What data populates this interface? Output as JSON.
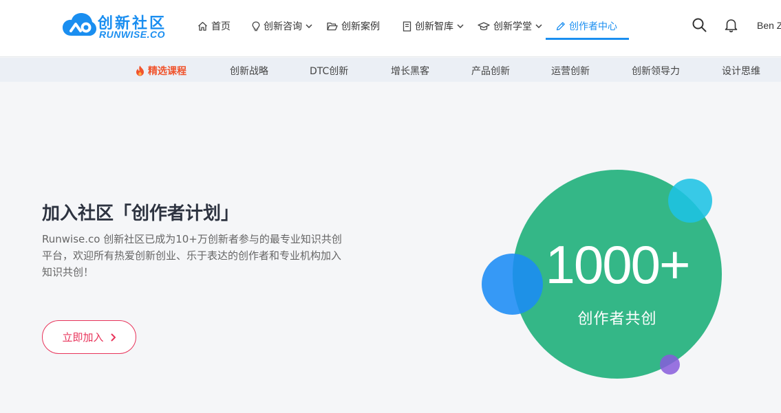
{
  "brand": {
    "name_cn": "创新社区",
    "name_en": "RUNWISE.CO",
    "color": "#1a8ef0"
  },
  "nav": {
    "items": [
      {
        "label": "首页",
        "icon": "home-icon",
        "dropdown": false,
        "active": false
      },
      {
        "label": "创新咨询",
        "icon": "lightbulb-icon",
        "dropdown": true,
        "active": false
      },
      {
        "label": "创新案例",
        "icon": "folder-open-icon",
        "dropdown": false,
        "active": false
      },
      {
        "label": "创新智库",
        "icon": "book-icon",
        "dropdown": true,
        "active": false
      },
      {
        "label": "创新学堂",
        "icon": "graduation-cap-icon",
        "dropdown": true,
        "active": false
      },
      {
        "label": "创作者中心",
        "icon": "pencil-icon",
        "dropdown": false,
        "active": true
      }
    ],
    "user_name": "Ben Z"
  },
  "subnav": {
    "items": [
      {
        "label": "精选课程",
        "hot": true
      },
      {
        "label": "创新战略"
      },
      {
        "label": "DTC创新"
      },
      {
        "label": "增长黑客"
      },
      {
        "label": "产品创新"
      },
      {
        "label": "运营创新"
      },
      {
        "label": "创新领导力"
      },
      {
        "label": "设计思维"
      }
    ],
    "hot_color": "#f0542d"
  },
  "hero": {
    "title": "加入社区「创作者计划」",
    "description": "Runwise.co 创新社区已成为10+万创新者参与的最专业知识共创平台，欢迎所有热爱创新创业、乐于表达的创作者和专业机构加入知识共创！",
    "cta_label": "立即加入",
    "cta_color": "#e8335a"
  },
  "stat": {
    "value": "1000+",
    "label": "创作者共创",
    "colors": {
      "main": "#34b787",
      "blue": "#1b8cf5",
      "cyan": "#1ec3e4",
      "purple": "#875cdc"
    }
  }
}
